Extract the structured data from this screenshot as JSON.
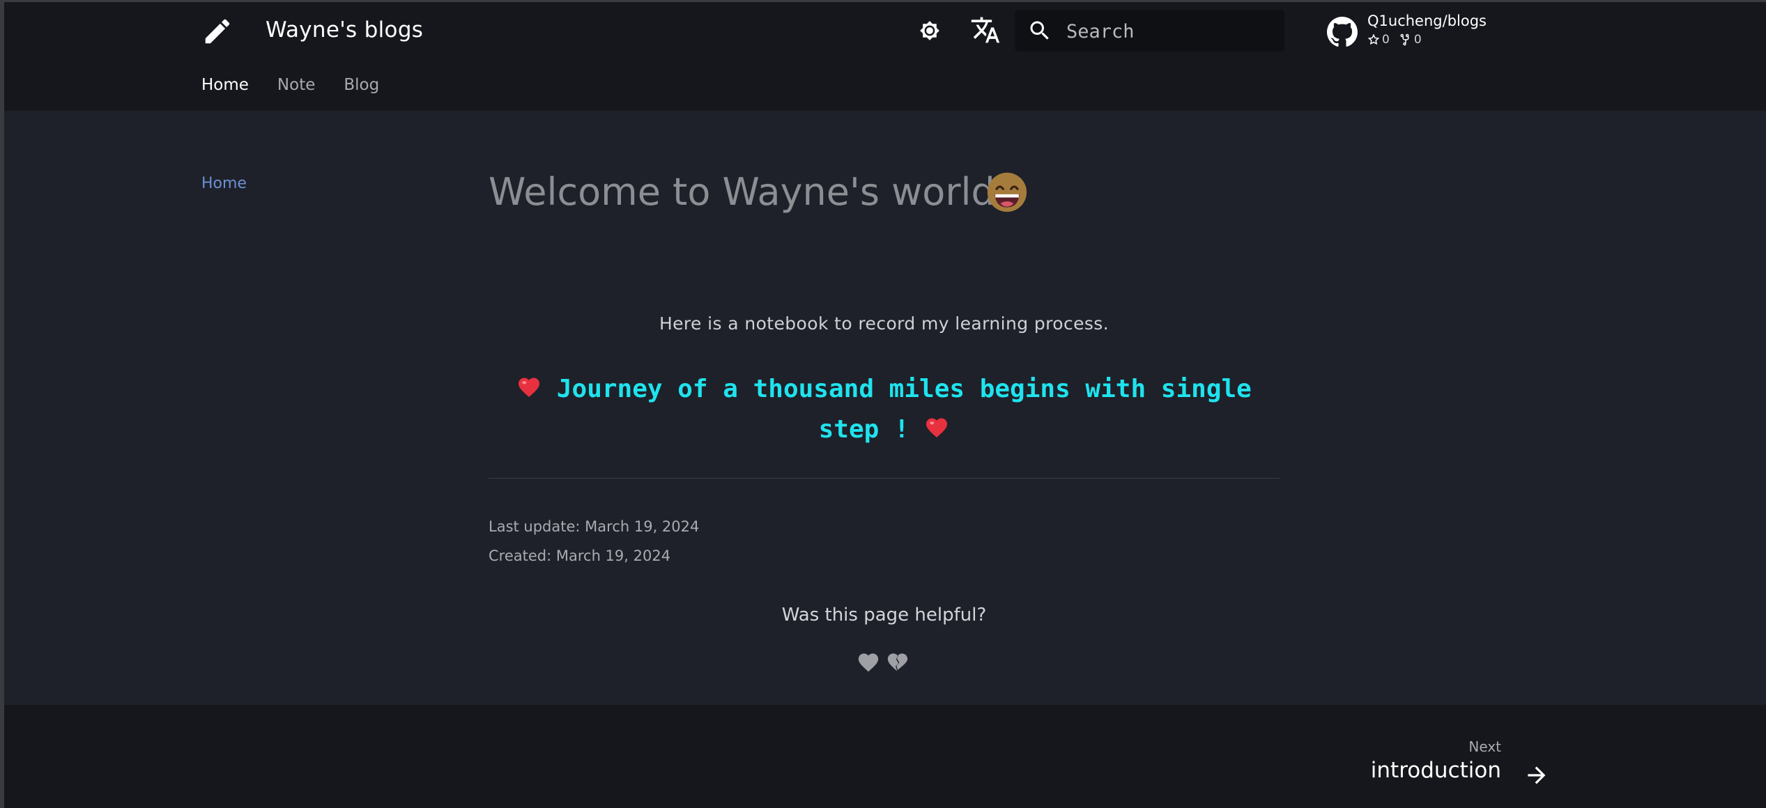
{
  "header": {
    "site_title": "Wayne's blogs",
    "search_placeholder": "Search",
    "repo": {
      "name": "Q1ucheng/blogs",
      "stars": "0",
      "forks": "0"
    },
    "tabs": [
      {
        "label": "Home",
        "active": true
      },
      {
        "label": "Note",
        "active": false
      },
      {
        "label": "Blog",
        "active": false
      }
    ],
    "icons": [
      "pencil-icon",
      "theme-toggle-icon",
      "translate-icon",
      "search-icon",
      "github-icon"
    ]
  },
  "sidebar": {
    "items": [
      {
        "label": "Home"
      }
    ]
  },
  "main": {
    "title": "Welcome to Wayne's world !",
    "title_emoji": "grinning-face-emoji",
    "intro": "Here is a notebook to record my learning process.",
    "quote": "Journey of a thousand miles begins with single step !",
    "quote_emoji": "red-heart-emoji",
    "last_update": "Last update: March 19, 2024",
    "created": "Created: March 19, 2024",
    "feedback_question": "Was this page helpful?",
    "feedback_icons": [
      "heart-icon",
      "broken-heart-icon"
    ]
  },
  "footer": {
    "next_label": "Next",
    "next_title": "introduction"
  },
  "colors": {
    "header_bg": "#16171c",
    "page_bg": "#1e2129",
    "accent_link": "#6e8fd6",
    "quote_cyan": "#1fe3ee",
    "heart_red": "#e8313f"
  }
}
